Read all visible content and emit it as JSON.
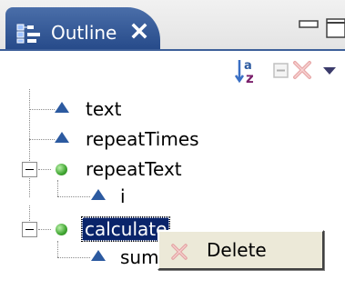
{
  "tab": {
    "title": "Outline"
  },
  "toolbar": {
    "sort": "Sort",
    "collapse_all": "Collapse All",
    "remove": "Remove",
    "view_menu": "View Menu"
  },
  "tree": {
    "items": [
      {
        "label": "text",
        "kind": "field",
        "depth": 1
      },
      {
        "label": "repeatTimes",
        "kind": "field",
        "depth": 1
      },
      {
        "label": "repeatText",
        "kind": "method",
        "depth": 1,
        "expanded": true
      },
      {
        "label": "i",
        "kind": "field",
        "depth": 2
      },
      {
        "label": "calculate",
        "kind": "method",
        "depth": 1,
        "expanded": true,
        "selected": true
      },
      {
        "label": "sum",
        "kind": "field",
        "depth": 2
      }
    ]
  },
  "context_menu": {
    "items": [
      {
        "label": "Delete",
        "icon": "delete-icon"
      }
    ]
  },
  "colors": {
    "tab_active": "#274b8a",
    "selection": "#0a246a",
    "field_icon": "#2c5aa0",
    "method_icon": "#3fa531",
    "menu_bg": "#ece9d8"
  }
}
